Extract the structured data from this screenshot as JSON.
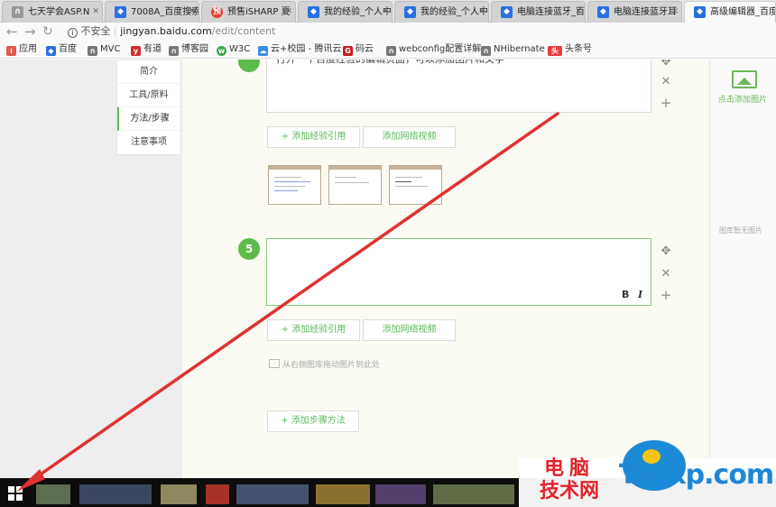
{
  "browser": {
    "tabs": [
      {
        "label": "七天学会ASP.N",
        "icon": "baidu-jingyan-icon",
        "color": "#999"
      },
      {
        "label": "7008A_百度搜索",
        "icon": "baidu-paw-icon",
        "color": "#2a6fe0"
      },
      {
        "label": "预售iSHARP 夏",
        "icon": "sale-icon",
        "color": "#e2412e"
      },
      {
        "label": "我的经验_个人中",
        "icon": "baidu-paw-icon",
        "color": "#2a6fe0"
      },
      {
        "label": "我的经验_个人中",
        "icon": "baidu-paw-icon",
        "color": "#2a6fe0"
      },
      {
        "label": "电脑连接蓝牙_百",
        "icon": "baidu-paw-icon",
        "color": "#2a6fe0"
      },
      {
        "label": "电脑连接蓝牙耳",
        "icon": "baidu-paw-icon",
        "color": "#2a6fe0"
      },
      {
        "label": "高级编辑器_百度",
        "icon": "baidu-paw-icon",
        "color": "#2a6fe0",
        "active": true
      }
    ],
    "security_label": "不安全",
    "url_domain": "jingyan.baidu.com",
    "url_path": "/edit/content",
    "bookmarks": [
      {
        "label": "应用",
        "icon": "apps-grid-icon",
        "color": "#e3584a"
      },
      {
        "label": "百度",
        "icon": "baidu-paw-icon",
        "color": "#2a6fe0"
      },
      {
        "label": "MVC",
        "icon": "jingyan-icon",
        "color": "#555"
      },
      {
        "label": "有道",
        "icon": "youdao-icon",
        "color": "#d32b2b"
      },
      {
        "label": "博客园",
        "icon": "jingyan-icon",
        "color": "#555"
      },
      {
        "label": "W3C",
        "icon": "w3c-icon",
        "color": "#3aa84a"
      },
      {
        "label": "云+校园 - 腾讯云",
        "icon": "cloud-icon",
        "color": "#3a8ee6"
      },
      {
        "label": "码云",
        "icon": "gitee-icon",
        "color": "#c71d23"
      },
      {
        "label": "webconfig配置详解",
        "icon": "jingyan-icon",
        "color": "#555"
      },
      {
        "label": "NHibernate",
        "icon": "jingyan-icon",
        "color": "#555"
      },
      {
        "label": "头条号",
        "icon": "toutiao-icon",
        "color": "#e83b3b"
      }
    ]
  },
  "sidebar": {
    "items": [
      {
        "label": "简介"
      },
      {
        "label": "工具/原料"
      },
      {
        "label": "方法/步骤",
        "current": true
      },
      {
        "label": "注意事项"
      }
    ]
  },
  "editor": {
    "step4_text": "打开一个百度经验的编辑页面，可以添加图片和文字",
    "step5_number": "5",
    "add_reference": "+ 添加经验引用",
    "add_video": "添加网络视频",
    "drag_hint": "从右侧图库拖动图片到此处",
    "add_step": "+ 添加步骤方法",
    "bold": "B",
    "italic": "I"
  },
  "right_panel": {
    "add_image_label": "点击添加图片",
    "no_image_label": "图库暂无图片"
  },
  "watermark": {
    "line1": "电脑",
    "line2": "技术网",
    "site": "Tagxp.com"
  },
  "colors": {
    "accent_green": "#5cb85c",
    "annotation_red": "#e03131"
  }
}
